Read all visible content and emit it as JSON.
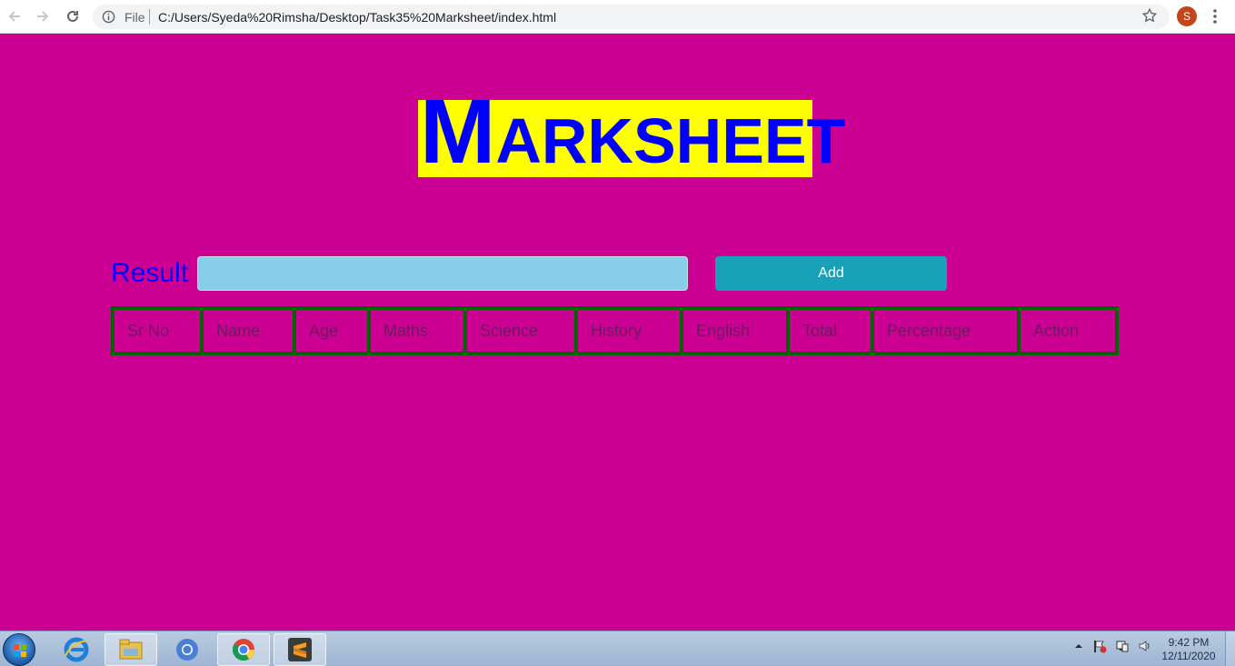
{
  "browser": {
    "file_label": "File",
    "url": "C:/Users/Syeda%20Rimsha/Desktop/Task35%20Marksheet/index.html",
    "profile_initial": "S"
  },
  "page": {
    "title_first": "M",
    "title_rest": "ARKSHEET",
    "result_label": "Result",
    "result_input_value": "",
    "add_label": "Add",
    "columns": [
      "Sr No",
      "Name",
      "Age",
      "Maths",
      "Science",
      "History",
      "English",
      "Total",
      "Percentage",
      "Action"
    ]
  },
  "taskbar": {
    "time": "9:42 PM",
    "date": "12/11/2020"
  },
  "colors": {
    "page_bg": "#cc0092",
    "title_bg": "#ffff00",
    "title_text": "#0000ff",
    "input_bg": "#87ceeb",
    "button_bg": "#17a2b8",
    "table_border": "#006400"
  }
}
